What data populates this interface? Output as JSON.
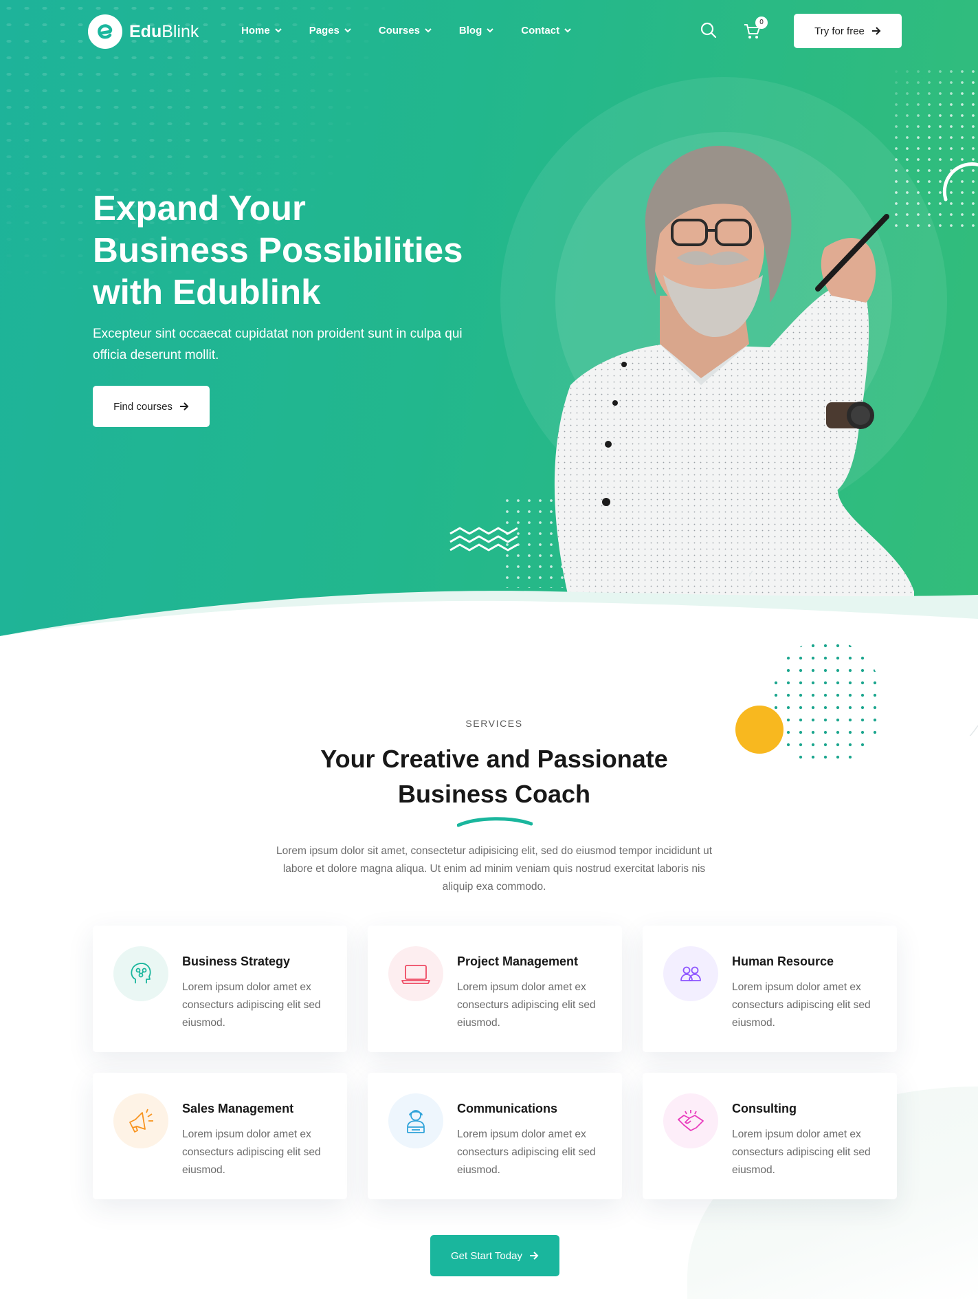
{
  "brand": {
    "name_bold": "Edu",
    "name_light": "Blink",
    "logo_letter": "e"
  },
  "nav": {
    "items": [
      {
        "label": "Home"
      },
      {
        "label": "Pages"
      },
      {
        "label": "Courses"
      },
      {
        "label": "Blog"
      },
      {
        "label": "Contact"
      }
    ],
    "cart_count": "0",
    "try_label": "Try for free"
  },
  "hero": {
    "title_line1": "Expand Your",
    "title_line2": "Business Possibilities",
    "title_line3": "with Edublink",
    "subtitle": "Excepteur sint occaecat cupidatat non proident sunt in culpa qui officia deserunt mollit.",
    "button_label": "Find courses"
  },
  "services": {
    "label": "SERVICES",
    "title_line1": "Your Creative and Passionate",
    "title_line2": "Business Coach",
    "description": "Lorem ipsum dolor sit amet, consectetur adipisicing elit, sed do eiusmod tempor incididunt ut labore et dolore magna aliqua. Ut enim ad minim veniam quis nostrud exercitat laboris nis aliquip exa commodo.",
    "cards": [
      {
        "title": "Business Strategy",
        "text": "Lorem ipsum dolor amet ex consecturs adipiscing elit sed eiusmod.",
        "icon": "brain-strategy-icon"
      },
      {
        "title": "Project Management",
        "text": "Lorem ipsum dolor amet ex consecturs adipiscing elit sed eiusmod.",
        "icon": "laptop-icon"
      },
      {
        "title": "Human Resource",
        "text": "Lorem ipsum dolor amet ex consecturs adipiscing elit sed eiusmod.",
        "icon": "team-icon"
      },
      {
        "title": "Sales Management",
        "text": "Lorem ipsum dolor amet ex consecturs adipiscing elit sed eiusmod.",
        "icon": "megaphone-icon"
      },
      {
        "title": "Communications",
        "text": "Lorem ipsum dolor amet ex consecturs adipiscing elit sed eiusmod.",
        "icon": "support-agent-icon"
      },
      {
        "title": "Consulting",
        "text": "Lorem ipsum dolor amet ex consecturs adipiscing elit sed eiusmod.",
        "icon": "handshake-icon"
      }
    ],
    "cta_label": "Get Start Today"
  },
  "colors": {
    "primary": "#1ab69d",
    "hero_gradient_start": "#1eb39a",
    "hero_gradient_end": "#33bd7a",
    "accent_yellow": "#f8b81f",
    "icon_teal": "#1ab69d",
    "icon_red": "#ee4a62",
    "icon_purple": "#8e56ff",
    "icon_orange": "#f8941f",
    "icon_blue": "#4664e4",
    "icon_pink": "#e93cbd"
  }
}
